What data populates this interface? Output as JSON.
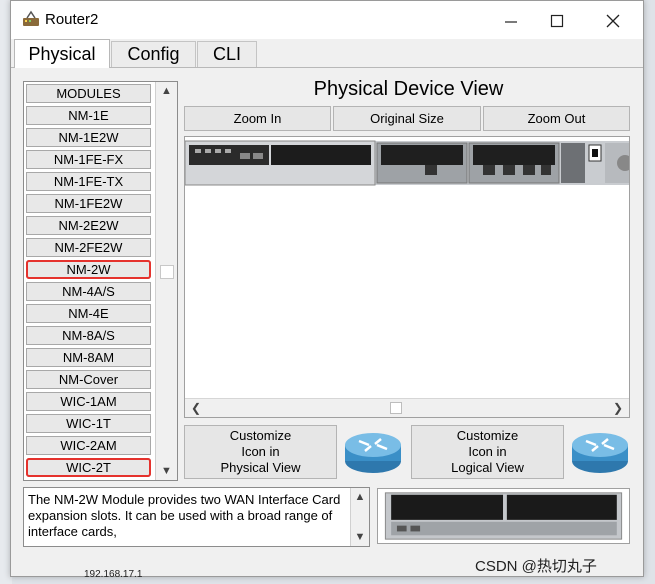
{
  "window": {
    "title": "Router2"
  },
  "tabs": [
    {
      "label": "Physical",
      "active": true
    },
    {
      "label": "Config",
      "active": false
    },
    {
      "label": "CLI",
      "active": false
    }
  ],
  "modules": {
    "header": "MODULES",
    "items": [
      {
        "label": "NM-1E",
        "highlighted": false
      },
      {
        "label": "NM-1E2W",
        "highlighted": false
      },
      {
        "label": "NM-1FE-FX",
        "highlighted": false
      },
      {
        "label": "NM-1FE-TX",
        "highlighted": false
      },
      {
        "label": "NM-1FE2W",
        "highlighted": false
      },
      {
        "label": "NM-2E2W",
        "highlighted": false
      },
      {
        "label": "NM-2FE2W",
        "highlighted": false
      },
      {
        "label": "NM-2W",
        "highlighted": true
      },
      {
        "label": "NM-4A/S",
        "highlighted": false
      },
      {
        "label": "NM-4E",
        "highlighted": false
      },
      {
        "label": "NM-8A/S",
        "highlighted": false
      },
      {
        "label": "NM-8AM",
        "highlighted": false
      },
      {
        "label": "NM-Cover",
        "highlighted": false
      },
      {
        "label": "WIC-1AM",
        "highlighted": false
      },
      {
        "label": "WIC-1T",
        "highlighted": false
      },
      {
        "label": "WIC-2AM",
        "highlighted": false
      },
      {
        "label": "WIC-2T",
        "highlighted": true
      }
    ]
  },
  "device_view": {
    "title": "Physical Device View",
    "zoom_in": "Zoom In",
    "original_size": "Original Size",
    "zoom_out": "Zoom Out"
  },
  "customize": {
    "physical": "Customize\nIcon in\nPhysical View",
    "logical": "Customize\nIcon in\nLogical View"
  },
  "description": "The NM-2W Module provides two WAN Interface Card expansion slots. It can be used with a broad range of interface cards,",
  "background": {
    "watermark": "CSDN @热切丸子",
    "bottom_ip": "192.168.17.1"
  },
  "colors": {
    "highlight": "#e5322d",
    "router_blue": "#3a8fc7"
  }
}
